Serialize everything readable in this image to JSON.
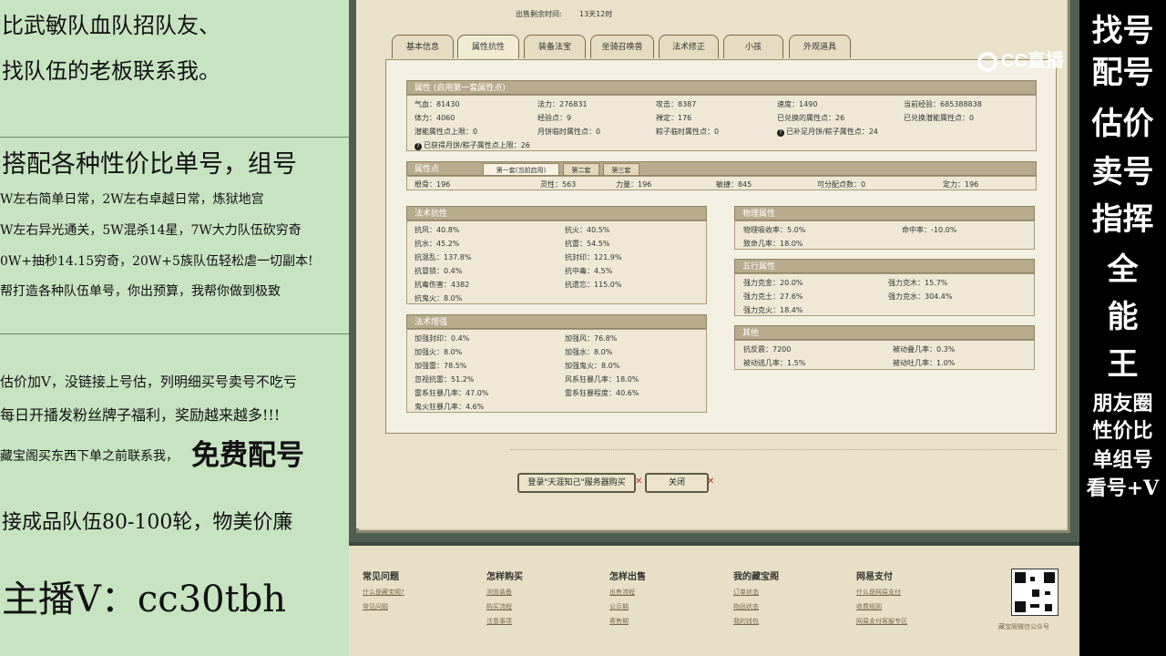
{
  "left_panel": {
    "line1": "比武敏队血队招队友、",
    "line2": "找队伍的老板联系我。",
    "line3": "搭配各种性价比单号，组号",
    "line4": "W左右简单日常，2W左右卓越日常，炼狱地宫",
    "line5": "W左右异光通关，5W混杀14星，7W大力队伍砍穷奇",
    "line6": "0W+抽秒14.15穷奇，20W+5族队伍轻松虐一切副本!",
    "line7": "帮打造各种队伍单号，你出预算，我帮你做到极致",
    "line8": "估价加V，没链接上号估，列明细买号卖号不吃亏",
    "line9": "每日开播发粉丝牌子福利，奖励越来越多!!!",
    "line10a": "藏宝阁买东西下单之前联系我，",
    "line10b": "免费配号",
    "line11": "接成品队伍80-100轮，物美价廉",
    "line12": "主播V：cc30tbh"
  },
  "right_panel": {
    "chars": [
      "找号",
      "配号",
      "估价",
      "卖号",
      "指挥",
      "全",
      "能",
      "王"
    ],
    "small": [
      "朋友圈",
      "性价比",
      "单组号",
      "看号+V"
    ]
  },
  "logo": "CC直播",
  "game": {
    "sale_label": "出售剩余时间:",
    "sale_value": "13天12时",
    "tabs": [
      "基本信息",
      "属性抗性",
      "装备法宝",
      "坐骑召唤兽",
      "法术修正",
      "小孩",
      "外观道具"
    ],
    "attr": {
      "header": "属性 (启用第一套属性点)",
      "rows": [
        [
          "气血：81430",
          "法力：276831",
          "攻击：8387",
          "速度：1490",
          "当前经验：685388838"
        ],
        [
          "体力：4060",
          "经验点：9",
          "禅定：176",
          "已兑换的属性点：26",
          "已兑换潜能属性点：0"
        ],
        [
          "潜能属性点上限：0",
          "月饼临时属性点：0",
          "粽子临时属性点：0",
          "已补足月饼/粽子属性点：24",
          ""
        ],
        [
          "已获得月饼/粽子属性点上限：26",
          "",
          "",
          "",
          ""
        ]
      ]
    },
    "points": {
      "header": "属性点",
      "subtabs": [
        "第一套(当前启用)",
        "第二套",
        "第三套"
      ],
      "values": [
        "根骨：196",
        "灵性：563",
        "力量：196",
        "敏捷：845",
        "可分配点数：0",
        "定力：196"
      ]
    },
    "resist": {
      "header": "法术抗性",
      "left": [
        "抗风：40.8%",
        "抗水：45.2%",
        "抗混乱：137.8%",
        "抗冒锁：0.4%",
        "抗毒伤害：4382",
        "抗鬼火：8.0%"
      ],
      "right": [
        "抗火：40.5%",
        "抗雷：54.5%",
        "抗封印：121.9%",
        "抗中毒：4.5%",
        "抗遗忘：115.0%",
        ""
      ]
    },
    "enhance": {
      "header": "法术增强",
      "left": [
        "加强封印：0.4%",
        "加强火：8.0%",
        "加强雷：78.5%",
        "忽视抗雷：51.2%",
        "雷系狂暴几率：47.0%",
        "鬼火狂暴几率：4.6%"
      ],
      "right": [
        "加强风：76.8%",
        "加强水：8.0%",
        "加强鬼火：8.0%",
        "风系狂暴几率：18.0%",
        "雷系狂暴程度：40.6%",
        ""
      ]
    },
    "physical": {
      "header": "物理属性",
      "left": [
        "物理吸收率：5.0%",
        "致命几率：18.0%"
      ],
      "right": [
        "命中率：-10.0%",
        ""
      ]
    },
    "five": {
      "header": "五行属性",
      "left": [
        "强力克金：20.0%",
        "强力克土：27.6%",
        "强力克火：18.4%"
      ],
      "right": [
        "强力克木：15.7%",
        "强力克水：304.4%",
        ""
      ]
    },
    "other": {
      "header": "其他",
      "left": [
        "抗反震：7200",
        "被动逃几率：1.5%"
      ],
      "right": [
        "被动叠几率：0.3%",
        "被动吐几率：1.0%"
      ]
    },
    "btn_login": "登录\"天涯知己\"服务器购买",
    "btn_close": "关闭"
  },
  "footer": {
    "cols": [
      {
        "title": "常见问题",
        "links": [
          "什么是藏宝阁?",
          "常见问题"
        ]
      },
      {
        "title": "怎样购买",
        "links": [
          "浏览装备",
          "购买流程",
          "注意事项"
        ]
      },
      {
        "title": "怎样出售",
        "links": [
          "出售流程",
          "公示期",
          "寄售期"
        ]
      },
      {
        "title": "我的藏宝阁",
        "links": [
          "订单状态",
          "物品状态",
          "我的钱包"
        ]
      },
      {
        "title": "网易支付",
        "links": [
          "什么是网易支付",
          "收费规则",
          "网易支付客服专区"
        ]
      }
    ],
    "qr_caption": "藏宝阁微信公众号"
  }
}
